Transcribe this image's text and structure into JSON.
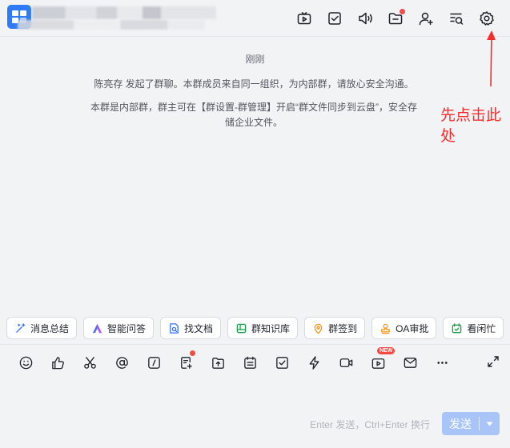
{
  "header": {
    "icons": [
      "video-icon",
      "todo-check-icon",
      "announcement-icon",
      "folder-icon",
      "add-member-icon",
      "search-history-icon",
      "settings-icon"
    ]
  },
  "chat": {
    "time": "刚刚",
    "message1": "陈亮存 发起了群聊。本群成员来自同一组织，为内部群，请放心安全沟通。",
    "message2": "本群是内部群，群主可在【群设置-群管理】开启“群文件同步到云盘”，安全存储企业文件。"
  },
  "annotation": {
    "text": "先点击此处",
    "color": "#f52c2c"
  },
  "quick_actions": [
    {
      "label": "消息总结",
      "icon": "sparkle-icon"
    },
    {
      "label": "智能问答",
      "icon": "ai-icon"
    },
    {
      "label": "找文档",
      "icon": "doc-search-icon"
    },
    {
      "label": "群知识库",
      "icon": "knowledge-icon"
    },
    {
      "label": "群签到",
      "icon": "location-icon"
    },
    {
      "label": "OA审批",
      "icon": "stamp-icon"
    },
    {
      "label": "看闲忙",
      "icon": "calendar-check-icon"
    }
  ],
  "toolbar": {
    "new_badge": "NEW"
  },
  "composer": {
    "hint": "Enter 发送，Ctrl+Enter 换行",
    "send_label": "发送"
  },
  "colors": {
    "accent": "#2f7bf5",
    "send_disabled": "#a9c5f8",
    "badge": "#f54a45"
  }
}
